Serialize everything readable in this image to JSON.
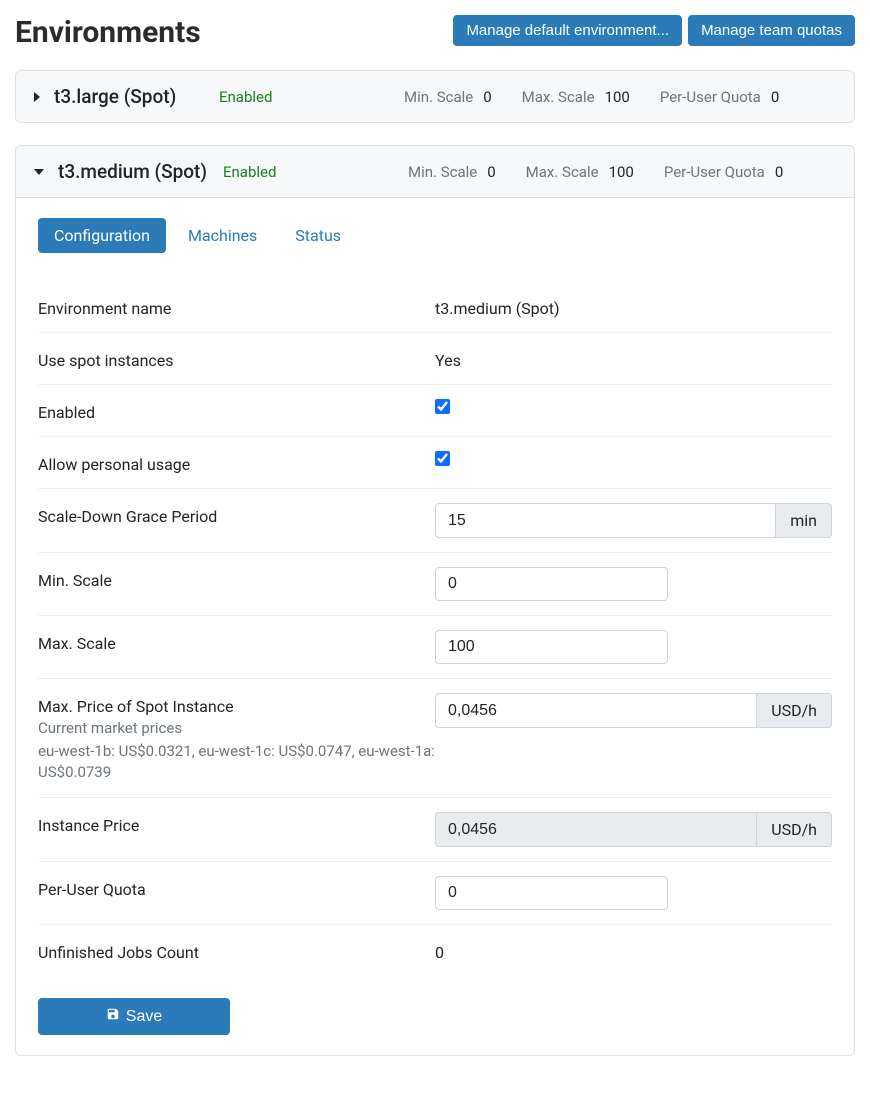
{
  "page": {
    "title": "Environments",
    "manage_default_label": "Manage default environment...",
    "manage_quotas_label": "Manage team quotas"
  },
  "stat_labels": {
    "min_scale": "Min. Scale",
    "max_scale": "Max. Scale",
    "per_user_quota": "Per-User Quota"
  },
  "env_collapsed": {
    "name": "t3.large (Spot)",
    "status": "Enabled",
    "min_scale": "0",
    "max_scale": "100",
    "per_user_quota": "0"
  },
  "env_expanded": {
    "name": "t3.medium (Spot)",
    "status": "Enabled",
    "min_scale": "0",
    "max_scale": "100",
    "per_user_quota": "0"
  },
  "tabs": {
    "configuration": "Configuration",
    "machines": "Machines",
    "status": "Status"
  },
  "form": {
    "labels": {
      "env_name": "Environment name",
      "use_spot": "Use spot instances",
      "enabled": "Enabled",
      "allow_personal": "Allow personal usage",
      "grace_period": "Scale-Down Grace Period",
      "min_scale": "Min. Scale",
      "max_scale": "Max. Scale",
      "max_price": "Max. Price of Spot Instance",
      "market_title": "Current market prices",
      "market_detail": "eu-west-1b: US$0.0321, eu-west-1c: US$0.0747, eu-west-1a: US$0.0739",
      "instance_price": "Instance Price",
      "per_user_quota": "Per-User Quota",
      "unfinished_jobs": "Unfinished Jobs Count"
    },
    "values": {
      "env_name": "t3.medium (Spot)",
      "use_spot": "Yes",
      "enabled_checked": true,
      "allow_personal_checked": true,
      "grace_period": "15",
      "grace_period_unit": "min",
      "min_scale": "0",
      "max_scale": "100",
      "max_price": "0,0456",
      "price_unit": "USD/h",
      "instance_price": "0,0456",
      "per_user_quota": "0",
      "unfinished_jobs": "0"
    },
    "save_label": "Save"
  }
}
